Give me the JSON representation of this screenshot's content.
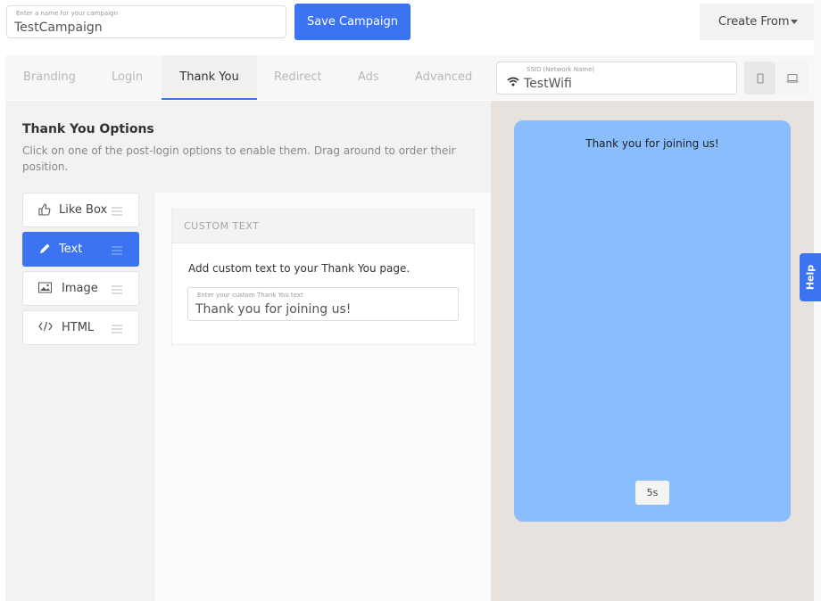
{
  "campaign": {
    "name_label": "Enter a name for your campaign",
    "name_value": "TestCampaign",
    "save_label": "Save Campaign",
    "create_from_label": "Create From"
  },
  "tabs": [
    {
      "label": "Branding"
    },
    {
      "label": "Login"
    },
    {
      "label": "Thank You"
    },
    {
      "label": "Redirect"
    },
    {
      "label": "Ads"
    },
    {
      "label": "Advanced"
    }
  ],
  "active_tab": "Thank You",
  "ssid": {
    "label": "SSID (Network Name)",
    "value": "TestWifi",
    "icon": "wifi-icon"
  },
  "devices": [
    {
      "icon": "mobile-icon",
      "selected": true
    },
    {
      "icon": "desktop-icon",
      "selected": false
    }
  ],
  "options": {
    "title": "Thank You Options",
    "description": "Click on one of the post-login options to enable them. Drag around to order their position.",
    "items": [
      {
        "label": "Like Box",
        "icon": "thumbs-up-icon",
        "active": false
      },
      {
        "label": "Text",
        "icon": "pencil-icon",
        "active": true
      },
      {
        "label": "Image",
        "icon": "image-icon",
        "active": false
      },
      {
        "label": "HTML",
        "icon": "code-icon",
        "active": false
      }
    ]
  },
  "custom_text": {
    "header": "CUSTOM TEXT",
    "description": "Add custom text to your Thank You page.",
    "field_label": "Enter your custom Thank You text",
    "field_value": "Thank you for joining us!"
  },
  "preview": {
    "message": "Thank you for joining us!",
    "timer": "5s"
  },
  "help_label": "Help",
  "colors": {
    "accent": "#3b73f0",
    "preview_bg": "#89bdfb"
  }
}
